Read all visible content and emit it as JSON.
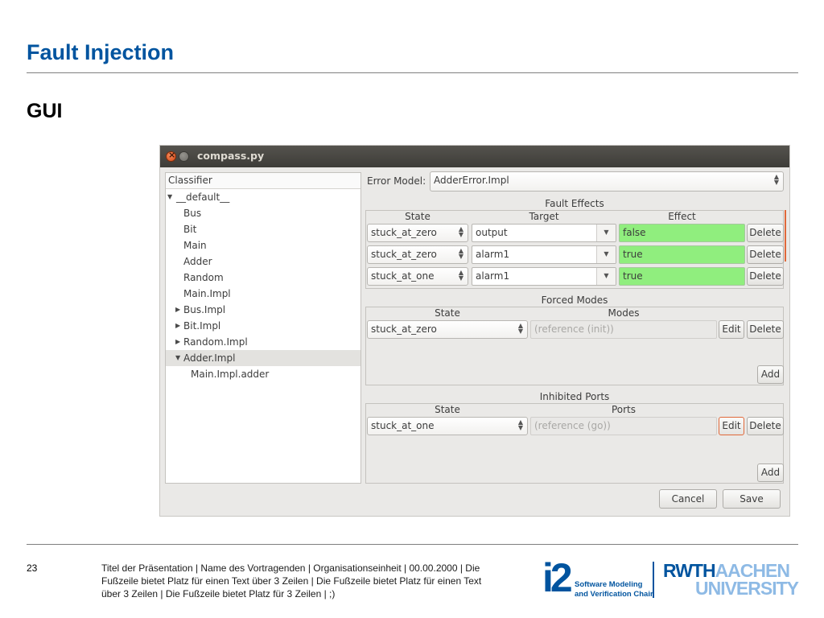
{
  "slide": {
    "title": "Fault Injection",
    "subtitle": "GUI",
    "page_number": "23",
    "footer": "Titel der Präsentation  |  Name des Vortragenden  |  Organisationseinheit  |  00.00.2000  |  Die Fußzeile bietet Platz für einen Text über 3 Zeilen  |  Die Fußzeile bietet Platz für einen Text über 3 Zeilen  |  Die Fußzeile bietet Platz für 3 Zeilen  | ;)",
    "logo_i2": {
      "mark": "i2",
      "line1": "Software Modeling",
      "line2": "and Verification Chair"
    },
    "logo_rwth": {
      "part1": "RWTH",
      "part2": "AACHEN",
      "part3": "UNIVERSITY"
    },
    "colors": {
      "title": "#00549f",
      "rwth_blue": "#00549f",
      "rwth_light_blue": "#8ebae5"
    }
  },
  "window": {
    "title": "compass.py",
    "classifier": {
      "header": "Classifier",
      "items": [
        {
          "label": "__default__",
          "level": 0,
          "arrow": "expanded"
        },
        {
          "label": "Bus",
          "level": 1,
          "arrow": "none"
        },
        {
          "label": "Bit",
          "level": 1,
          "arrow": "none"
        },
        {
          "label": "Main",
          "level": 1,
          "arrow": "none"
        },
        {
          "label": "Adder",
          "level": 1,
          "arrow": "none"
        },
        {
          "label": "Random",
          "level": 1,
          "arrow": "none"
        },
        {
          "label": "Main.Impl",
          "level": 1,
          "arrow": "none"
        },
        {
          "label": "Bus.Impl",
          "level": 1,
          "arrow": "collapsed"
        },
        {
          "label": "Bit.Impl",
          "level": 1,
          "arrow": "collapsed"
        },
        {
          "label": "Random.Impl",
          "level": 1,
          "arrow": "collapsed"
        },
        {
          "label": "Adder.Impl",
          "level": 1,
          "arrow": "expanded",
          "selected": true
        },
        {
          "label": "Main.Impl.adder",
          "level": 2,
          "arrow": "none"
        }
      ]
    },
    "error_model": {
      "label": "Error Model:",
      "value": "AdderError.Impl"
    },
    "fault_effects": {
      "title": "Fault Effects",
      "columns": [
        "State",
        "Target",
        "Effect"
      ],
      "rows": [
        {
          "state": "stuck_at_zero",
          "target": "output",
          "effect": "false",
          "delete": "Delete"
        },
        {
          "state": "stuck_at_zero",
          "target": "alarm1",
          "effect": "true",
          "delete": "Delete"
        },
        {
          "state": "stuck_at_one",
          "target": "alarm1",
          "effect": "true",
          "delete": "Delete"
        }
      ]
    },
    "forced_modes": {
      "title": "Forced Modes",
      "columns": [
        "State",
        "Modes"
      ],
      "rows": [
        {
          "state": "stuck_at_zero",
          "modes": "(reference (init))",
          "edit": "Edit",
          "delete": "Delete"
        }
      ],
      "add": "Add"
    },
    "inhibited_ports": {
      "title": "Inhibited Ports",
      "columns": [
        "State",
        "Ports"
      ],
      "rows": [
        {
          "state": "stuck_at_one",
          "ports": "(reference (go))",
          "edit": "Edit",
          "delete": "Delete"
        }
      ],
      "add": "Add"
    },
    "buttons": {
      "cancel": "Cancel",
      "save": "Save"
    },
    "icons": {
      "combo": "spinner-arrows-icon",
      "dropdown": "triangle-down-icon",
      "expanded": "triangle-down-icon",
      "collapsed": "triangle-right-icon"
    },
    "colors": {
      "effect_bg": "#90ee7e",
      "titlebar": "#3d3c38",
      "focus": "#e0683a",
      "selected_row": "#e3e2df"
    }
  }
}
